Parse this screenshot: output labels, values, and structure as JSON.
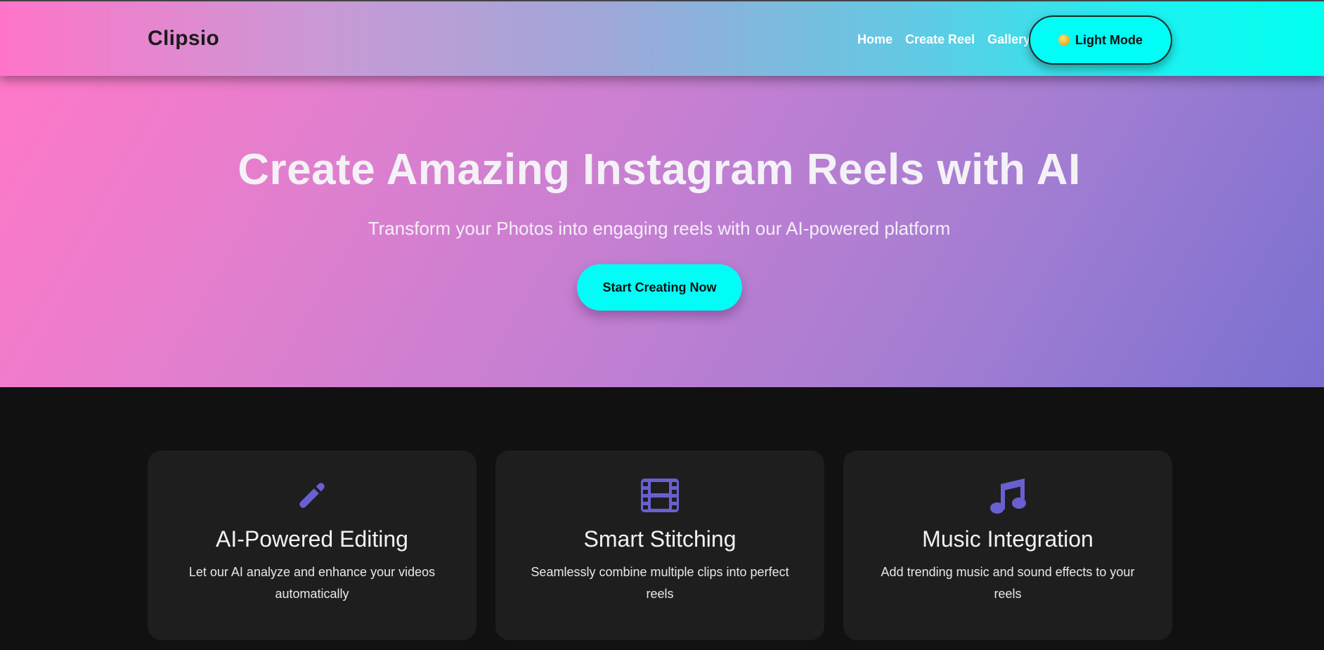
{
  "nav": {
    "brand": "Clipsio",
    "links": [
      "Home",
      "Create Reel",
      "Gallery"
    ],
    "theme_toggle_label": "Light Mode",
    "theme_toggle_icon": "sun-icon"
  },
  "hero": {
    "title": "Create Amazing Instagram Reels with AI",
    "subtitle": "Transform your Photos into engaging reels with our AI-powered platform",
    "cta_label": "Start Creating Now"
  },
  "features": [
    {
      "icon": "magic-wand-icon",
      "title": "AI-Powered Editing",
      "text": "Let our AI analyze and enhance your videos automatically"
    },
    {
      "icon": "film-icon",
      "title": "Smart Stitching",
      "text": "Seamlessly combine multiple clips into perfect reels"
    },
    {
      "icon": "music-note-icon",
      "title": "Music Integration",
      "text": "Add trending music and sound effects to your reels"
    }
  ],
  "colors": {
    "accent_cyan": "#00fdf6",
    "icon_purple": "#6a5fd0",
    "card_bg": "#1e1e1e",
    "page_bg": "#111111"
  }
}
